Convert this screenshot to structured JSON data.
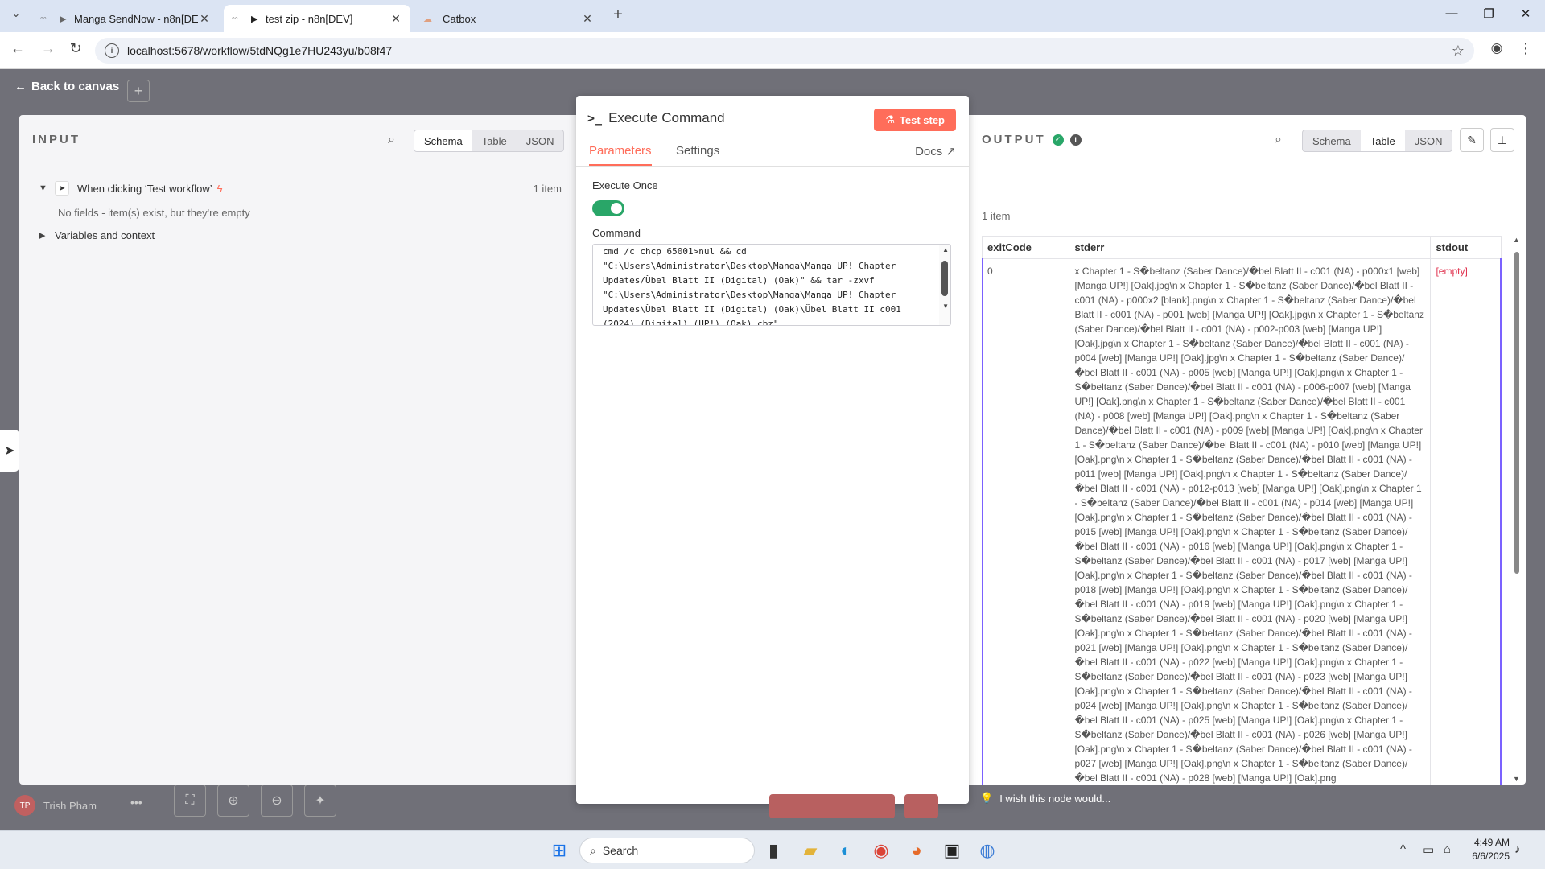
{
  "browser": {
    "tabs": [
      {
        "title": "Manga SendNow - n8n[DEV]",
        "icon": "n8n-icon"
      },
      {
        "title": "test zip - n8n[DEV]",
        "icon": "n8n-icon"
      },
      {
        "title": "Catbox",
        "icon": "catbox-icon"
      }
    ],
    "url": "localhost:5678/workflow/5tdNQg1e7HU243yu/b08f47"
  },
  "canvas": {
    "back_label": "Back to canvas",
    "user_name": "Trish Pham",
    "user_initials": "TP",
    "feedback_text": "I wish this node would..."
  },
  "input": {
    "title": "INPUT",
    "views": [
      "Schema",
      "Table",
      "JSON"
    ],
    "selected_view": "Schema",
    "trigger_name": "When clicking ‘Test workflow’",
    "item_count": "1 item",
    "empty_note": "No fields - item(s) exist, but they're empty",
    "variables_label": "Variables and context"
  },
  "node": {
    "title": "Execute Command",
    "test_label": "Test step",
    "tabs": [
      "Parameters",
      "Settings"
    ],
    "docs_label": "Docs",
    "execute_once_label": "Execute Once",
    "execute_once": true,
    "command_label": "Command",
    "command": "cmd /c chcp 65001>nul && cd\n\"C:\\Users\\Administrator\\Desktop\\Manga\\Manga UP! Chapter\nUpdates/Übel Blatt II (Digital) (Oak)\" && tar -zxvf\n\"C:\\Users\\Administrator\\Desktop\\Manga\\Manga UP! Chapter\nUpdates\\Übel Blatt II (Digital) (Oak)\\Übel Blatt II c001\n(2024) (Digital) (UP!) (Oak).cbz\""
  },
  "output": {
    "title": "OUTPUT",
    "views": [
      "Schema",
      "Table",
      "JSON"
    ],
    "selected_view": "Table",
    "item_count": "1 item",
    "columns": [
      "exitCode",
      "stderr",
      "stdout"
    ],
    "row": {
      "exitCode": "0",
      "stderr": "x Chapter 1 - S�beltanz (Saber Dance)/�bel Blatt II - c001 (NA) - p000x1 [web] [Manga UP!] [Oak].jpg\\n x Chapter 1 - S�beltanz (Saber Dance)/�bel Blatt II - c001 (NA) - p000x2 [blank].png\\n x Chapter 1 - S�beltanz (Saber Dance)/�bel Blatt II - c001 (NA) - p001 [web] [Manga UP!] [Oak].jpg\\n x Chapter 1 - S�beltanz (Saber Dance)/�bel Blatt II - c001 (NA) - p002-p003 [web] [Manga UP!] [Oak].jpg\\n x Chapter 1 - S�beltanz (Saber Dance)/�bel Blatt II - c001 (NA) - p004 [web] [Manga UP!] [Oak].jpg\\n x Chapter 1 - S�beltanz (Saber Dance)/�bel Blatt II - c001 (NA) - p005 [web] [Manga UP!] [Oak].png\\n x Chapter 1 - S�beltanz (Saber Dance)/�bel Blatt II - c001 (NA) - p006-p007 [web] [Manga UP!] [Oak].png\\n x Chapter 1 - S�beltanz (Saber Dance)/�bel Blatt II - c001 (NA) - p008 [web] [Manga UP!] [Oak].png\\n x Chapter 1 - S�beltanz (Saber Dance)/�bel Blatt II - c001 (NA) - p009 [web] [Manga UP!] [Oak].png\\n x Chapter 1 - S�beltanz (Saber Dance)/�bel Blatt II - c001 (NA) - p010 [web] [Manga UP!] [Oak].png\\n x Chapter 1 - S�beltanz (Saber Dance)/�bel Blatt II - c001 (NA) - p011 [web] [Manga UP!] [Oak].png\\n x Chapter 1 - S�beltanz (Saber Dance)/�bel Blatt II - c001 (NA) - p012-p013 [web] [Manga UP!] [Oak].png\\n x Chapter 1 - S�beltanz (Saber Dance)/�bel Blatt II - c001 (NA) - p014 [web] [Manga UP!] [Oak].png\\n x Chapter 1 - S�beltanz (Saber Dance)/�bel Blatt II - c001 (NA) - p015 [web] [Manga UP!] [Oak].png\\n x Chapter 1 - S�beltanz (Saber Dance)/�bel Blatt II - c001 (NA) - p016 [web] [Manga UP!] [Oak].png\\n x Chapter 1 - S�beltanz (Saber Dance)/�bel Blatt II - c001 (NA) - p017 [web] [Manga UP!] [Oak].png\\n x Chapter 1 - S�beltanz (Saber Dance)/�bel Blatt II - c001 (NA) - p018 [web] [Manga UP!] [Oak].png\\n x Chapter 1 - S�beltanz (Saber Dance)/�bel Blatt II - c001 (NA) - p019 [web] [Manga UP!] [Oak].png\\n x Chapter 1 - S�beltanz (Saber Dance)/�bel Blatt II - c001 (NA) - p020 [web] [Manga UP!] [Oak].png\\n x Chapter 1 - S�beltanz (Saber Dance)/�bel Blatt II - c001 (NA) - p021 [web] [Manga UP!] [Oak].png\\n x Chapter 1 - S�beltanz (Saber Dance)/�bel Blatt II - c001 (NA) - p022 [web] [Manga UP!] [Oak].png\\n x Chapter 1 - S�beltanz (Saber Dance)/�bel Blatt II - c001 (NA) - p023 [web] [Manga UP!] [Oak].png\\n x Chapter 1 - S�beltanz (Saber Dance)/�bel Blatt II - c001 (NA) - p024 [web] [Manga UP!] [Oak].png\\n x Chapter 1 - S�beltanz (Saber Dance)/�bel Blatt II - c001 (NA) - p025 [web] [Manga UP!] [Oak].png\\n x Chapter 1 - S�beltanz (Saber Dance)/�bel Blatt II - c001 (NA) - p026 [web] [Manga UP!] [Oak].png\\n x Chapter 1 - S�beltanz (Saber Dance)/�bel Blatt II - c001 (NA) - p027 [web] [Manga UP!] [Oak].png\\n x Chapter 1 - S�beltanz (Saber Dance)/�bel Blatt II - c001 (NA) - p028 [web] [Manga UP!] [Oak].png",
      "stdout": "[empty]"
    }
  },
  "taskbar": {
    "search_label": "Search",
    "time": "4:49 AM",
    "date": "6/6/2025"
  },
  "colors": {
    "accent": "#ff6d5a",
    "success": "#29a668",
    "selection": "#7b61ff"
  }
}
